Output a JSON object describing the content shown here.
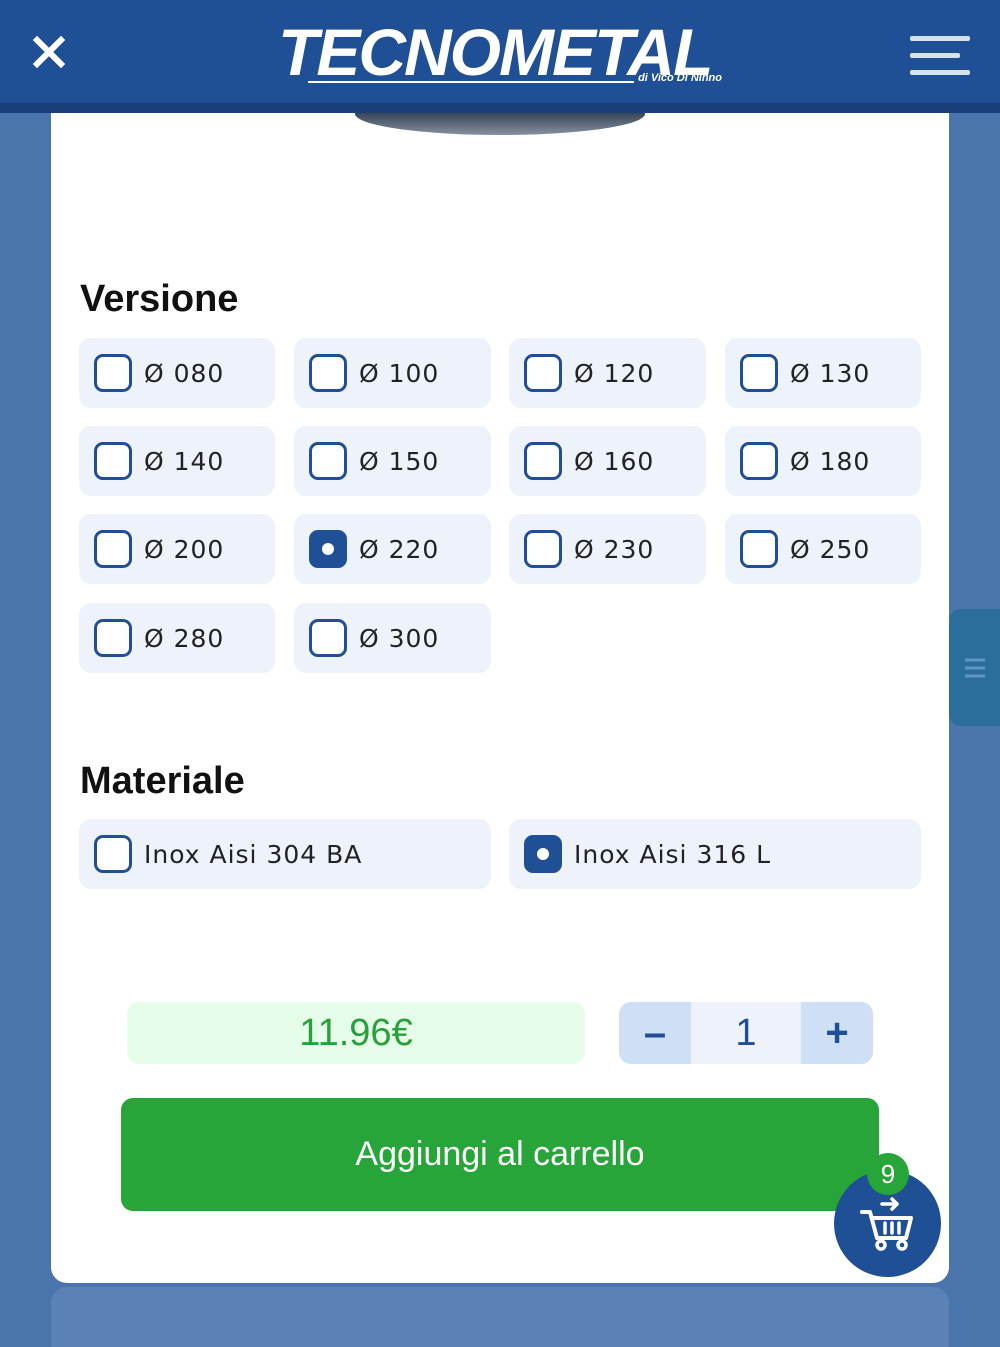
{
  "header": {
    "logo_text": "TECNOMETAL",
    "logo_subtitle": "di Vico Di Ninno",
    "close_icon": "close-icon",
    "menu_icon": "hamburger-menu-icon",
    "brand_color": "#1f4f95"
  },
  "versione": {
    "title": "Versione",
    "options": [
      {
        "label": "Ø 080",
        "checked": false
      },
      {
        "label": "Ø 100",
        "checked": false
      },
      {
        "label": "Ø 120",
        "checked": false
      },
      {
        "label": "Ø 130",
        "checked": false
      },
      {
        "label": "Ø 140",
        "checked": false
      },
      {
        "label": "Ø 150",
        "checked": false
      },
      {
        "label": "Ø 160",
        "checked": false
      },
      {
        "label": "Ø 180",
        "checked": false
      },
      {
        "label": "Ø 200",
        "checked": false
      },
      {
        "label": "Ø 220",
        "checked": true
      },
      {
        "label": "Ø 230",
        "checked": false
      },
      {
        "label": "Ø 250",
        "checked": false
      },
      {
        "label": "Ø 280",
        "checked": false
      },
      {
        "label": "Ø 300",
        "checked": false
      }
    ]
  },
  "materiale": {
    "title": "Materiale",
    "options": [
      {
        "label": "Inox Aisi 304 BA",
        "checked": false
      },
      {
        "label": "Inox Aisi 316 L",
        "checked": true
      }
    ]
  },
  "purchase": {
    "price": "11.96€",
    "quantity": "1",
    "minus_label": "–",
    "plus_label": "+",
    "add_to_cart_label": "Aggiungi al carrello",
    "price_color": "#2aa03a",
    "button_color": "#28a538"
  },
  "cart": {
    "badge_count": "9",
    "icon": "shopping-cart-icon"
  },
  "side_tab": {
    "icon": "list-lines-icon"
  }
}
